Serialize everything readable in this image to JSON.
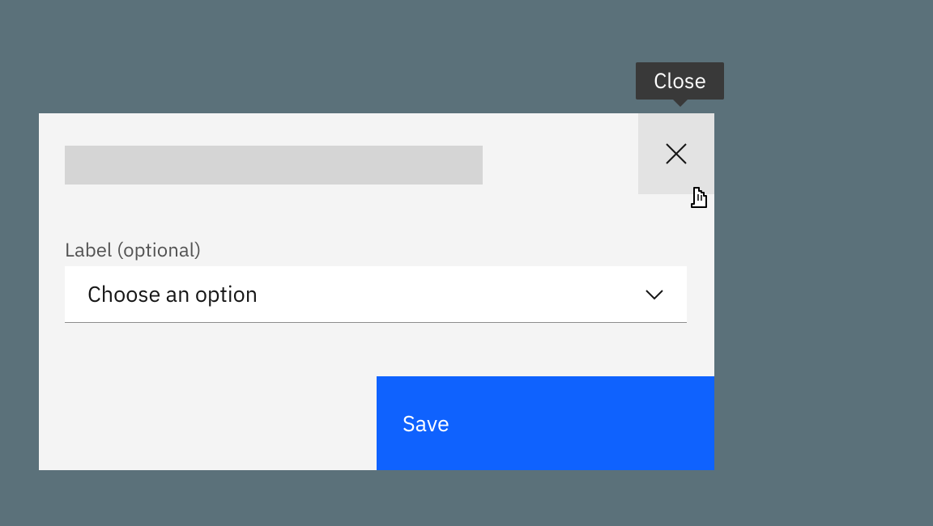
{
  "tooltip": {
    "text": "Close"
  },
  "modal": {
    "field_label": "Label (optional)",
    "dropdown": {
      "placeholder": "Choose an option"
    },
    "actions": {
      "save_label": "Save"
    }
  }
}
